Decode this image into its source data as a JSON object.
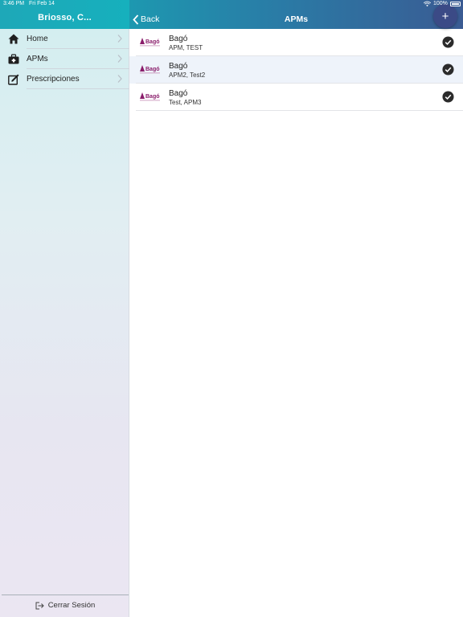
{
  "status_bar": {
    "time": "3:46 PM",
    "date": "Fri Feb 14",
    "battery": "100%"
  },
  "sidebar": {
    "title": "Briosso, C...",
    "items": [
      {
        "label": "Home",
        "icon": "home-icon"
      },
      {
        "label": "APMs",
        "icon": "briefcase-icon"
      },
      {
        "label": "Prescripciones",
        "icon": "edit-note-icon"
      }
    ],
    "logout_label": "Cerrar Sesión"
  },
  "navbar": {
    "back_label": "Back",
    "title": "APMs",
    "add_label": "+"
  },
  "apms": [
    {
      "title": "Bagó",
      "subtitle": "APM, TEST",
      "logo_text": "Bagó",
      "selected": false
    },
    {
      "title": "Bagó",
      "subtitle": "APM2, Test2",
      "logo_text": "Bagó",
      "selected": true
    },
    {
      "title": "Bagó",
      "subtitle": "Test, APM3",
      "logo_text": "Bagó",
      "selected": false
    }
  ],
  "colors": {
    "sidebar_header": "#16b0bd",
    "navbar_start": "#1d98b0",
    "navbar_end": "#3a5b93",
    "fab": "#3b4a86",
    "brand_logo": "#8a1d6b",
    "check": "#2b2b2b"
  }
}
